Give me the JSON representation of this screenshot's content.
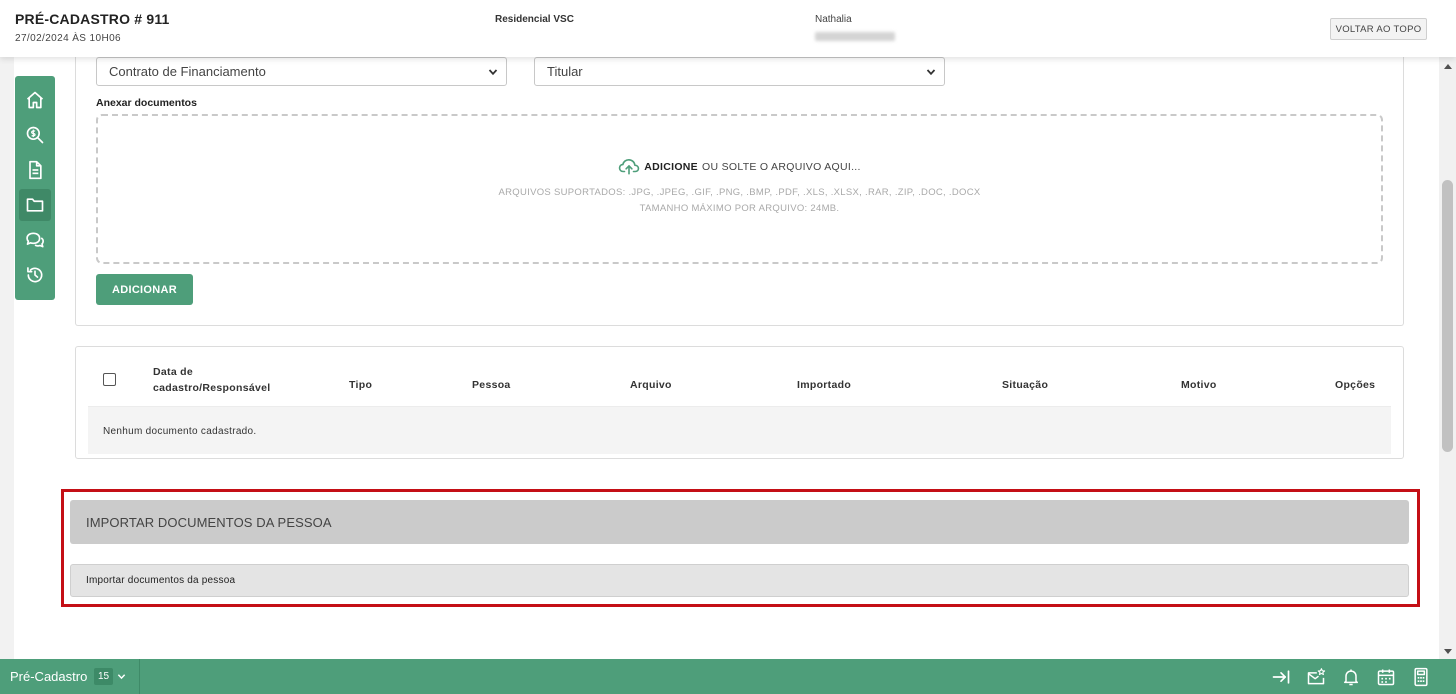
{
  "header": {
    "title": "PRÉ-CADASTRO # 911",
    "date": "27/02/2024 ÀS 10H06",
    "project": "Residencial VSC",
    "user_name": "Nathalia",
    "top_button": "VOLTAR AO TOPO"
  },
  "sidebar": {
    "items": [
      {
        "icon": "home-icon"
      },
      {
        "icon": "money-search-icon"
      },
      {
        "icon": "document-icon"
      },
      {
        "icon": "folder-icon",
        "active": true
      },
      {
        "icon": "chat-icon"
      },
      {
        "icon": "history-icon"
      }
    ]
  },
  "form": {
    "document_type_select": "Contrato de Financiamento",
    "person_select": "Titular",
    "attach_label": "Anexar documentos",
    "dropzone": {
      "action": "ADICIONE",
      "action_rest": "OU SOLTE O ARQUIVO AQUI...",
      "supported": "ARQUIVOS SUPORTADOS: .JPG, .JPEG, .GIF, .PNG, .BMP, .PDF, .XLS, .XLSX, .RAR, .ZIP, .DOC, .DOCX",
      "max_size": "TAMANHO MÁXIMO POR ARQUIVO: 24MB."
    },
    "add_button": "ADICIONAR"
  },
  "table": {
    "columns": {
      "date_line1": "Data de",
      "date_line2": "cadastro/Responsável",
      "type": "Tipo",
      "person": "Pessoa",
      "file": "Arquivo",
      "imported": "Importado",
      "status": "Situação",
      "reason": "Motivo",
      "options": "Opções"
    },
    "empty_message": "Nenhum documento cadastrado."
  },
  "import_section": {
    "title": "IMPORTAR DOCUMENTOS DA PESSOA",
    "item": "Importar documentos da pessoa"
  },
  "bottom_bar": {
    "label": "Pré-Cadastro",
    "count": "15"
  },
  "colors": {
    "brand_green": "#4e9e7a",
    "highlight_red": "#c40f16"
  }
}
